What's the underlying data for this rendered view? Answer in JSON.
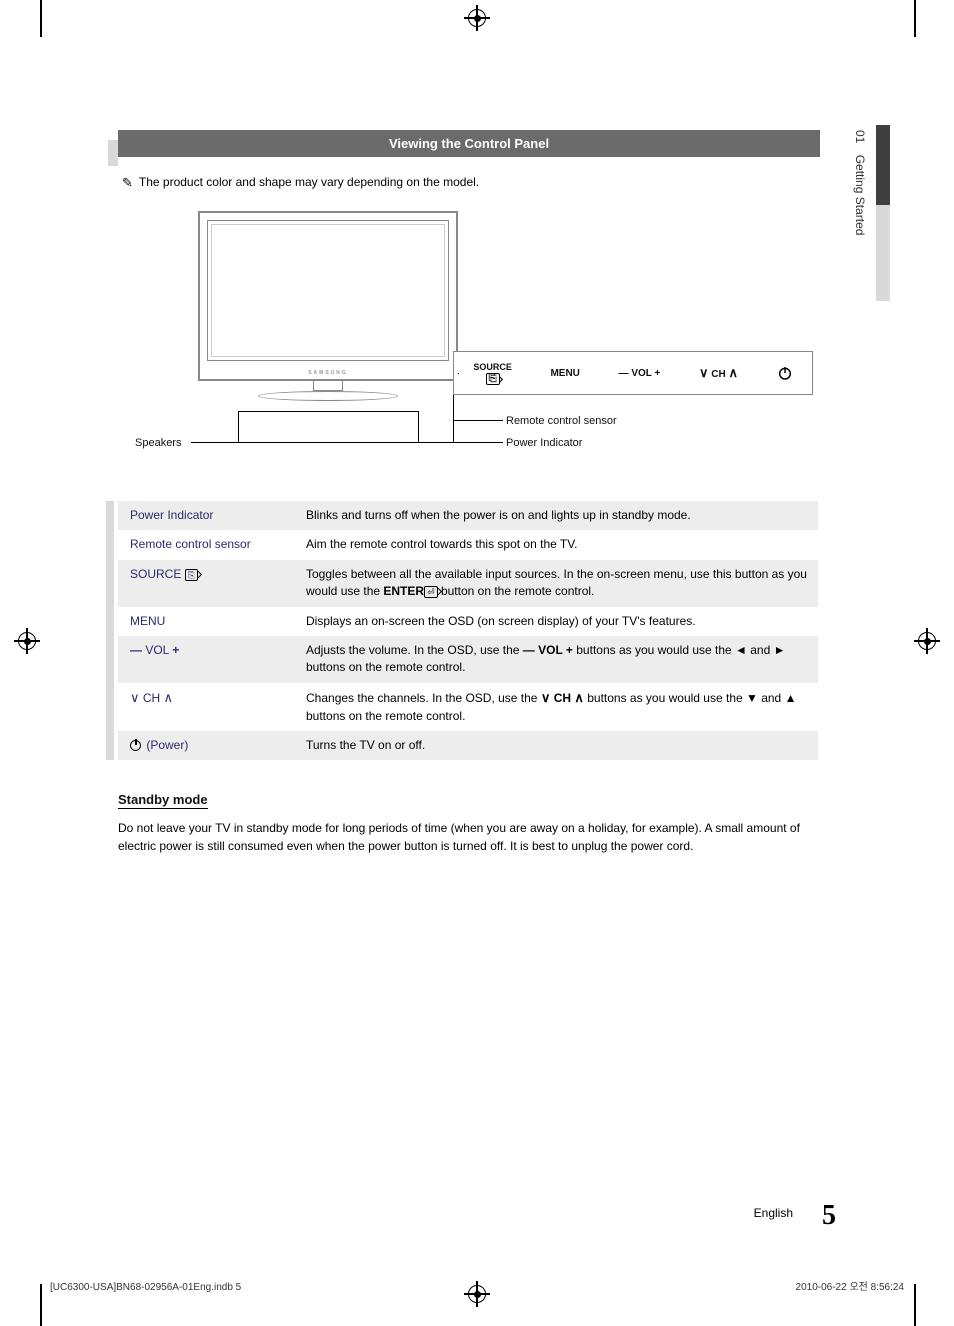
{
  "header": {
    "title": "Viewing the Control Panel"
  },
  "sidetab": {
    "number": "01",
    "label": "Getting Started"
  },
  "note": {
    "text": "The product color and shape may vary depending on the model."
  },
  "diagram": {
    "brand": "SAMSUNG",
    "buttons": {
      "source": "SOURCE",
      "menu": "MENU",
      "vol": "VOL",
      "ch": "CH"
    },
    "callouts": {
      "speakers": "Speakers",
      "remote_sensor": "Remote control sensor",
      "power_indicator": "Power Indicator"
    }
  },
  "table": [
    {
      "label": "Power Indicator",
      "desc": "Blinks and turns off when the power is on and lights up in standby mode."
    },
    {
      "label": "Remote control sensor",
      "desc": "Aim the remote control towards this spot on the TV."
    },
    {
      "label": "SOURCE",
      "desc_pre": "Toggles between all the available input sources. In the on-screen menu, use this button as you would use the ",
      "desc_mid": "ENTER",
      "desc_post": " button on the remote control."
    },
    {
      "label": "MENU",
      "desc": "Displays an on-screen the OSD (on screen display) of your TV's features."
    },
    {
      "label_pre": "VOL",
      "desc_pre": "Adjusts the volume. In the OSD, use the ",
      "desc_mid": "VOL",
      "desc_post": " buttons as you would use the ◄ and ► buttons on the remote control."
    },
    {
      "label_pre": "CH",
      "desc_pre": "Changes the channels. In the OSD, use the ",
      "desc_mid": "CH",
      "desc_post": " buttons as you would use the ▼ and ▲ buttons on the remote control."
    },
    {
      "label": "(Power)",
      "desc": "Turns the TV on or off."
    }
  ],
  "standby": {
    "heading": "Standby mode",
    "body": "Do not leave your TV in standby mode for long periods of time (when you are away on a holiday, for example). A small amount of electric power is still consumed even when the power button is turned off. It is best to unplug the power cord."
  },
  "footer": {
    "language": "English",
    "page_number": "5",
    "print_left": "[UC6300-USA]BN68-02956A-01Eng.indb   5",
    "print_right": "2010-06-22   오전 8:56:24"
  }
}
